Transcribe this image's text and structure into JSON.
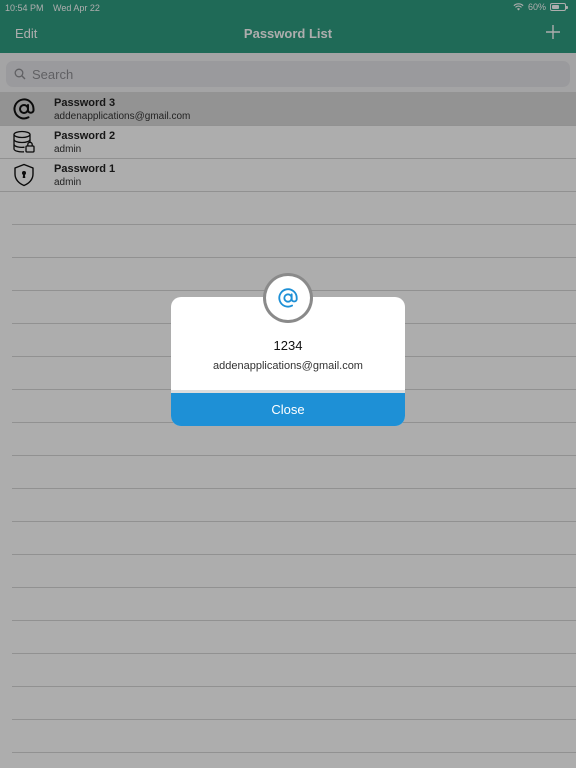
{
  "status_bar": {
    "time": "10:54 PM",
    "date": "Wed Apr 22",
    "battery": "60%",
    "battery_level": 0.6
  },
  "nav": {
    "edit_label": "Edit",
    "title": "Password List",
    "add_icon": "plus-icon"
  },
  "search": {
    "placeholder": "Search",
    "value": ""
  },
  "items": [
    {
      "title": "Password 3",
      "subtitle": "addenapplications@gmail.com",
      "icon": "at-sign-icon",
      "selected": true
    },
    {
      "title": "Password 2",
      "subtitle": "admin",
      "icon": "database-lock-icon",
      "selected": false
    },
    {
      "title": "Password 1",
      "subtitle": "admin",
      "icon": "shield-keyhole-icon",
      "selected": false
    }
  ],
  "modal": {
    "icon": "at-sign-icon",
    "password": "1234",
    "username": "addenapplications@gmail.com",
    "close_label": "Close"
  },
  "colors": {
    "nav_bg": "#2e9c80",
    "close_button": "#1e90d6",
    "modal_icon": "#1e90d6"
  }
}
